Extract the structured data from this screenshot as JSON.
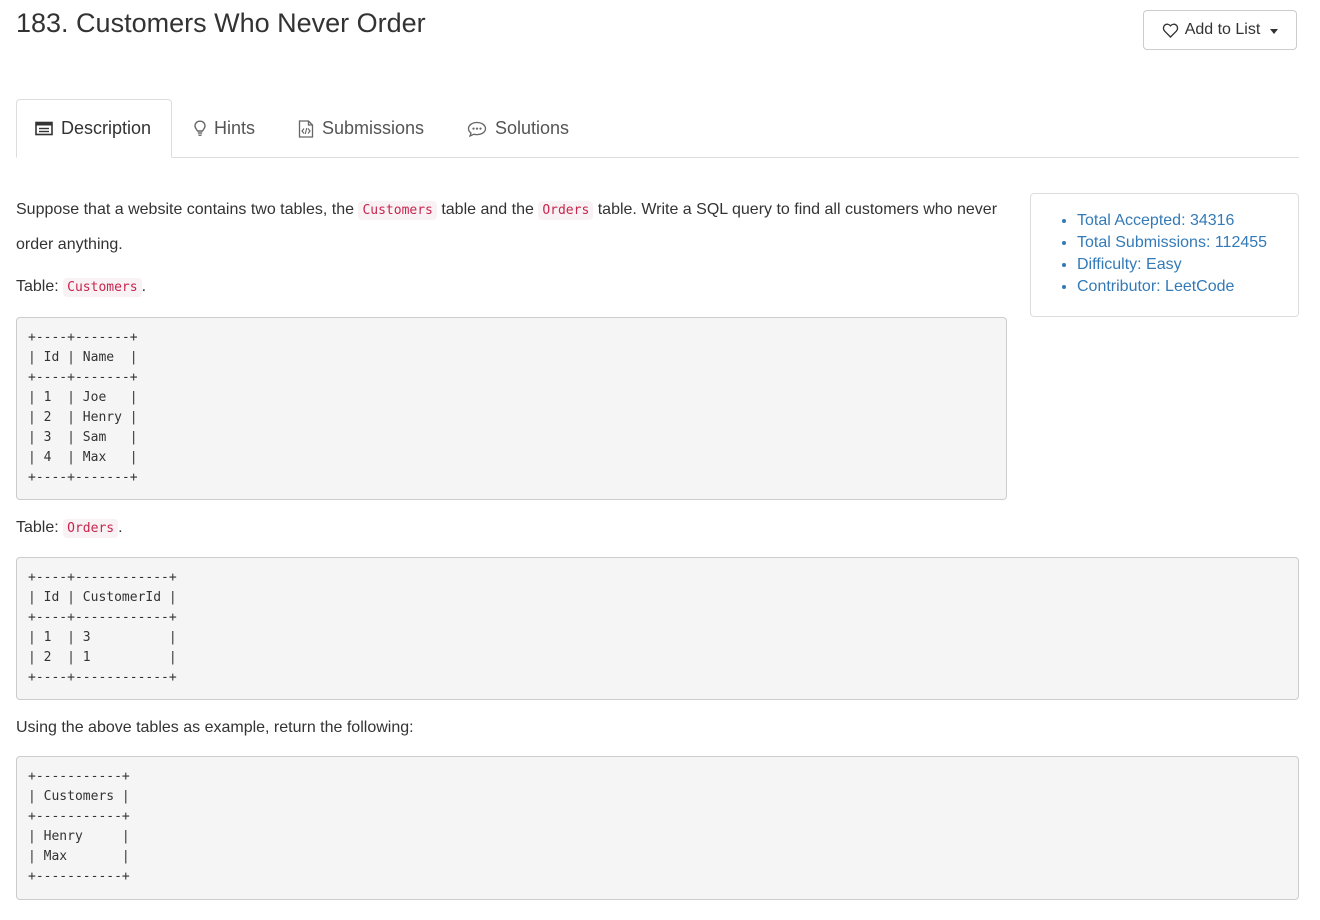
{
  "header": {
    "title": "183. Customers Who Never Order",
    "add_to_list_label": "Add to List"
  },
  "tabs": [
    {
      "label": "Description",
      "icon": "description-icon",
      "active": true
    },
    {
      "label": "Hints",
      "icon": "lightbulb-icon",
      "active": false
    },
    {
      "label": "Submissions",
      "icon": "code-file-icon",
      "active": false
    },
    {
      "label": "Solutions",
      "icon": "chat-bubble-icon",
      "active": false
    }
  ],
  "problem": {
    "intro_part1": "Suppose that a website contains two tables, the ",
    "intro_code1": "Customers",
    "intro_part2": " table and the ",
    "intro_code2": "Orders",
    "intro_part3": " table. Write a SQL query to find all customers who never order anything.",
    "table1_prefix": "Table: ",
    "table1_name": "Customers",
    "table1_suffix": ".",
    "table1_block": "+----+-------+\n| Id | Name  |\n+----+-------+\n| 1  | Joe   |\n| 2  | Henry |\n| 3  | Sam   |\n| 4  | Max   |\n+----+-------+",
    "table2_prefix": "Table: ",
    "table2_name": "Orders",
    "table2_suffix": ".",
    "table2_block": "+----+------------+\n| Id | CustomerId |\n+----+------------+\n| 1  | 3          |\n| 2  | 1          |\n+----+------------+",
    "result_intro": "Using the above tables as example, return the following:",
    "result_block": "+-----------+\n| Customers |\n+-----------+\n| Henry     |\n| Max       |\n+-----------+"
  },
  "stats": {
    "items": [
      "Total Accepted: 34316",
      "Total Submissions: 112455",
      "Difficulty: Easy",
      "Contributor: LeetCode"
    ]
  },
  "colors": {
    "link_blue": "#337ab7",
    "code_red": "#c7254e",
    "code_bg": "#f9f2f4",
    "pre_bg": "#f5f5f5"
  }
}
